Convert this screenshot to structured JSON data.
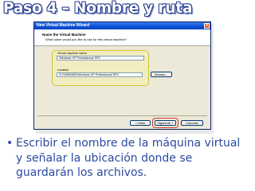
{
  "slide": {
    "title": "Paso 4 – Nombre y ruta",
    "bullet_symbol": "•",
    "bullet_text": "Escribir el nombre de la máquina virtual y señalar la ubicación donde se guardarán los archivos."
  },
  "wizard": {
    "window_title": "New Virtual Machine Wizard",
    "close_glyph": "x",
    "header_title": "Name the Virtual Machine",
    "header_subtitle": "What name would you like to use for this virtual machine?",
    "name_label": "Virtual machine name",
    "name_value": "Windows XP Professional SP2",
    "location_label": "Location",
    "location_value": "G:\\VMWARE\\Windows XP Professional SP2",
    "browse_label": "Browse...",
    "back_label": "< Atrás",
    "next_label": "Siguiente >",
    "cancel_label": "Cancelar"
  }
}
